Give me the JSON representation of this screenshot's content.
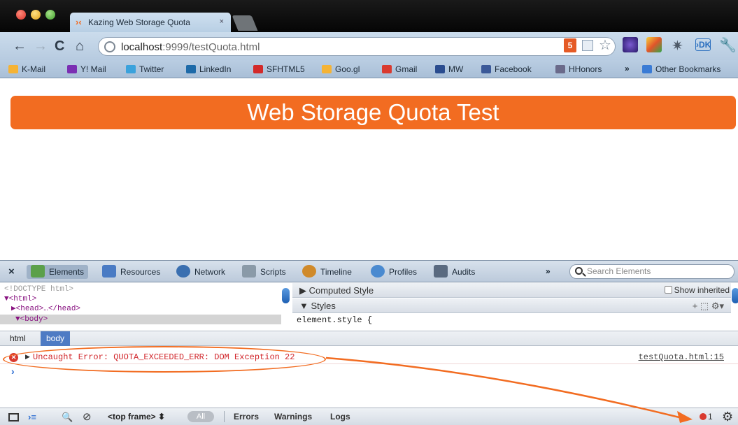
{
  "browser": {
    "tab_title": "Kazing Web Storage Quota",
    "tab_favicon": "kaazing-icon",
    "tab_close": "×",
    "url_host": "localhost",
    "url_rest": ":9999/testQuota.html",
    "html5_badge": "5"
  },
  "bookmarks": [
    {
      "label": "K-Mail",
      "icon": "kmail-icon",
      "color": "#f5b335"
    },
    {
      "label": "Y! Mail",
      "icon": "yahoo-mail-icon",
      "color": "#7b2fb3"
    },
    {
      "label": "Twitter",
      "icon": "twitter-icon",
      "color": "#3aa2dc"
    },
    {
      "label": "LinkedIn",
      "icon": "linkedin-icon",
      "color": "#1d6aa8"
    },
    {
      "label": "SFHTML5",
      "icon": "sfhtml5-icon",
      "color": "#d32a2a"
    },
    {
      "label": "Goo.gl",
      "icon": "googl-icon",
      "color": "#f5b335"
    },
    {
      "label": "Gmail",
      "icon": "gmail-icon",
      "color": "#d93a2f"
    },
    {
      "label": "MW",
      "icon": "mw-icon",
      "color": "#2a4c8f"
    },
    {
      "label": "Facebook",
      "icon": "facebook-icon",
      "color": "#3b5998"
    },
    {
      "label": "HHonors",
      "icon": "hhonors-icon",
      "color": "#6a6a8a"
    },
    {
      "label": "Other Bookmarks",
      "icon": "folder-icon",
      "color": "#3a7bd5"
    }
  ],
  "bookmarks_more": "»",
  "page": {
    "banner_title": "Web Storage Quota Test",
    "banner_color": "#f26c21"
  },
  "devtools": {
    "close": "×",
    "tabs": [
      {
        "label": "Elements",
        "icon": "elements-icon",
        "color": "#5ba04a",
        "active": true
      },
      {
        "label": "Resources",
        "icon": "resources-icon",
        "color": "#4a7bc4"
      },
      {
        "label": "Network",
        "icon": "network-icon",
        "color": "#3a6fb0"
      },
      {
        "label": "Scripts",
        "icon": "scripts-icon",
        "color": "#8a9aa8"
      },
      {
        "label": "Timeline",
        "icon": "timeline-icon",
        "color": "#d08a2a"
      },
      {
        "label": "Profiles",
        "icon": "profiles-icon",
        "color": "#4a8ad0"
      },
      {
        "label": "Audits",
        "icon": "audits-icon",
        "color": "#5a6a80"
      }
    ],
    "more": "»",
    "search_placeholder": "Search Elements",
    "dom": {
      "doctype": "<!DOCTYPE html>",
      "html_open": "▼<html>",
      "head": "▶<head>…</head>",
      "body": "▼<body>"
    },
    "computed_style": "▶ Computed Style",
    "show_inherited": "Show inherited",
    "styles": "▼ Styles",
    "styles_tools": "+ ⬚ ⚙▾",
    "element_style": "element.style {",
    "breadcrumb": [
      "html",
      "body"
    ],
    "console": {
      "error_message": "Uncaught Error: QUOTA_EXCEEDED_ERR: DOM Exception 22",
      "error_source": "testQuota.html:15",
      "prompt": "›"
    },
    "statusbar": {
      "frame_select": "<top frame>",
      "frame_arrows": "⬍",
      "filter_all": "All",
      "filter_errors": "Errors",
      "filter_warnings": "Warnings",
      "filter_logs": "Logs",
      "error_count": "1"
    }
  },
  "annotation": {
    "color": "#f26c21"
  }
}
